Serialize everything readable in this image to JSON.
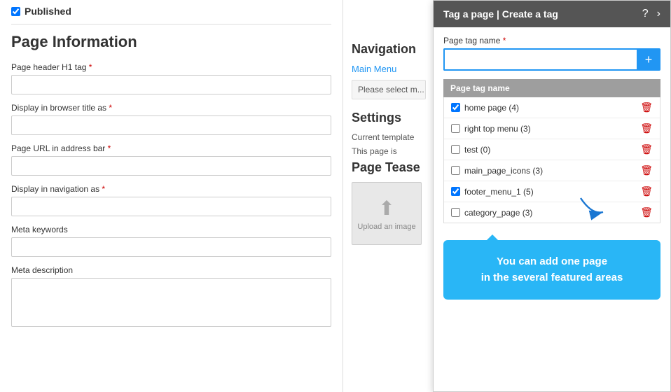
{
  "published": {
    "label": "Published",
    "checked": true
  },
  "page_information": {
    "title": "Page Information",
    "fields": [
      {
        "label": "Page header H1 tag",
        "required": true,
        "value": "",
        "type": "input"
      },
      {
        "label": "Display in browser title as",
        "required": true,
        "value": "",
        "type": "input"
      },
      {
        "label": "Page URL in address bar",
        "required": true,
        "value": "",
        "type": "input"
      },
      {
        "label": "Display in navigation as",
        "required": true,
        "value": "",
        "type": "input"
      },
      {
        "label": "Meta keywords",
        "required": false,
        "value": "",
        "type": "input"
      },
      {
        "label": "Meta description",
        "required": false,
        "value": "",
        "type": "textarea"
      }
    ]
  },
  "navigation": {
    "title": "Navigation",
    "main_menu_link": "Main Menu",
    "please_select_text": "Please select me..."
  },
  "settings": {
    "title": "Settings",
    "current_template_label": "Current template",
    "this_page_is_label": "This page is"
  },
  "page_teaser": {
    "title": "Page Tease",
    "upload_text": "Upload an image"
  },
  "tag_panel": {
    "title": "Tag a page | Create a tag",
    "help_btn": "?",
    "close_btn": "›",
    "tag_name_label": "Page tag name",
    "required": true,
    "tag_input_value": "",
    "add_btn_label": "+",
    "table_header": "Page tag name",
    "tags": [
      {
        "label": "home page (4)",
        "checked": true
      },
      {
        "label": "right top menu (3)",
        "checked": false
      },
      {
        "label": "test (0)",
        "checked": false
      },
      {
        "label": "main_page_icons (3)",
        "checked": false
      },
      {
        "label": "footer_menu_1 (5)",
        "checked": true
      },
      {
        "label": "category_page (3)",
        "checked": false
      }
    ],
    "callout_text": "You can add one page\nin the several featured areas"
  }
}
